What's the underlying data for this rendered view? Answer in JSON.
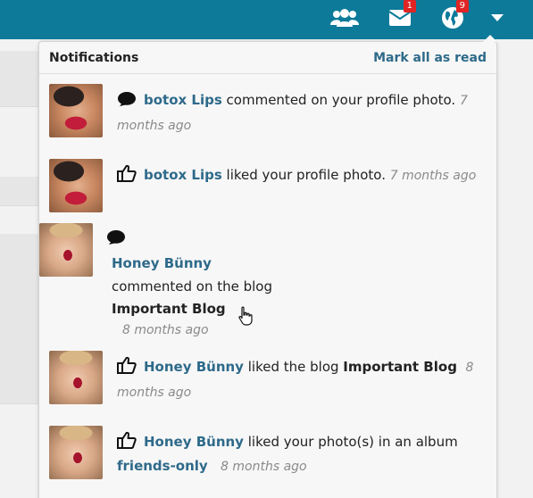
{
  "topbar": {
    "friends_icon": "friends-icon",
    "messages_icon": "envelope-icon",
    "messages_badge": "1",
    "notifications_icon": "globe-icon",
    "notifications_badge": "9",
    "menu_icon": "caret-down-icon",
    "color": "#0d7a99"
  },
  "panel": {
    "title": "Notifications",
    "mark_all": "Mark all as read"
  },
  "notifications": [
    {
      "type_icon": "comment-icon",
      "user": "botox Lips",
      "text": " commented on your profile photo. ",
      "time": "7 months ago"
    },
    {
      "type_icon": "thumbs-up-icon",
      "user": "botox Lips",
      "text": " liked your profile photo. ",
      "time": "7 months ago"
    },
    {
      "type_icon": "comment-icon",
      "user": "Honey Bünny",
      "text": "commented on the blog",
      "object": "Important Blog",
      "time": "8 months ago"
    },
    {
      "type_icon": "thumbs-up-icon",
      "user": "Honey Bünny",
      "text": " liked the blog ",
      "object": "Important Blog",
      "time": "8 months ago"
    },
    {
      "type_icon": "thumbs-up-icon",
      "user": "Honey Bünny",
      "text": " liked your photo(s) in an album",
      "object": "friends-only",
      "time": "8 months ago"
    }
  ],
  "colors": {
    "link": "#2e6a8a",
    "time": "#8a8a8a",
    "badge": "#e02424"
  }
}
